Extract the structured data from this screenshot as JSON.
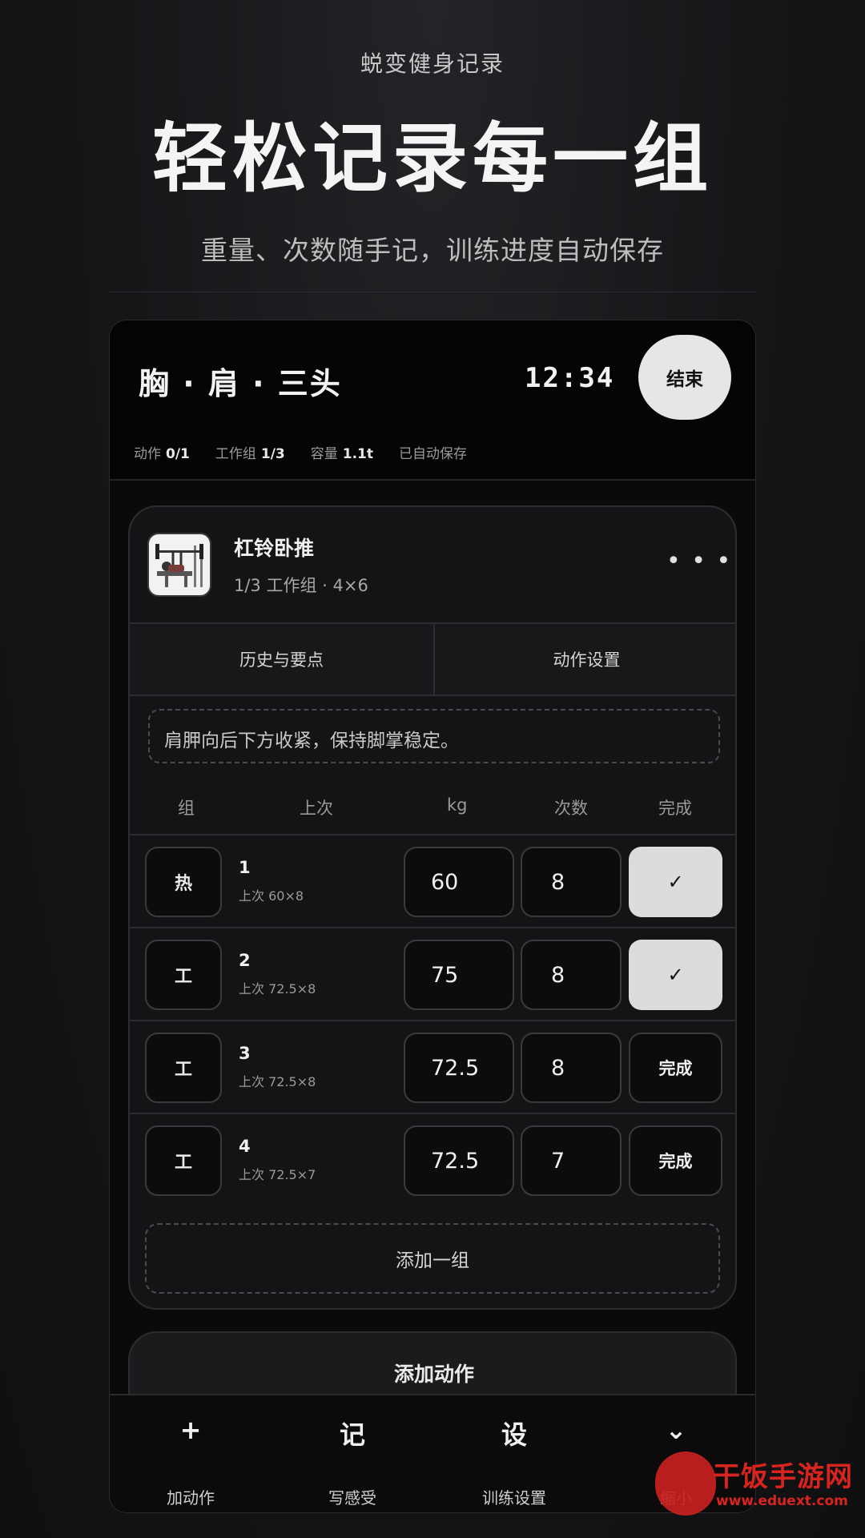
{
  "promo": {
    "subtitle": "蜕变健身记录",
    "title": "轻松记录每一组",
    "description": "重量、次数随手记，训练进度自动保存"
  },
  "header": {
    "session_title": "胸 · 肩 · 三头",
    "timer": "12:34",
    "end_label": "结束",
    "stats": [
      {
        "label": "动作",
        "value": "0/1"
      },
      {
        "label": "工作组",
        "value": "1/3"
      },
      {
        "label": "容量",
        "value": "1.1t"
      },
      {
        "label": "已自动保存",
        "value": ""
      }
    ]
  },
  "exercise": {
    "name": "杠铃卧推",
    "meta": "1/3 工作组 · 4×6",
    "more_icon": "more-icon",
    "tabs": [
      "历史与要点",
      "动作设置"
    ],
    "note": "肩胛向后下方收紧，保持脚掌稳定。",
    "columns": [
      "组",
      "上次",
      "kg",
      "次数",
      "完成"
    ],
    "sets": [
      {
        "type": "热",
        "number": "1",
        "previous": "上次 60×8",
        "kg": "60",
        "reps": "8",
        "done_label": "✓",
        "completed": true
      },
      {
        "type": "工",
        "number": "2",
        "previous": "上次 72.5×8",
        "kg": "75",
        "reps": "8",
        "done_label": "✓",
        "completed": true
      },
      {
        "type": "工",
        "number": "3",
        "previous": "上次 72.5×8",
        "kg": "72.5",
        "reps": "8",
        "done_label": "完成",
        "completed": false
      },
      {
        "type": "工",
        "number": "4",
        "previous": "上次 72.5×7",
        "kg": "72.5",
        "reps": "7",
        "done_label": "完成",
        "completed": false
      }
    ],
    "add_set_label": "添加一组"
  },
  "add_exercise_label": "添加动作",
  "bottom_nav": [
    {
      "glyph": "+",
      "label": "加动作",
      "icon": "plus-icon"
    },
    {
      "glyph": "记",
      "label": "写感受",
      "icon": "note-icon"
    },
    {
      "glyph": "设",
      "label": "训练设置",
      "icon": "settings-icon"
    },
    {
      "glyph": "⌄",
      "label": "缩小",
      "icon": "chevron-down-icon"
    }
  ],
  "watermark": {
    "text": "干饭手游网",
    "url": "www.eduext.com"
  },
  "colors": {
    "background": "#141517",
    "card": "#131416",
    "accent_light": "#dcdcdc",
    "watermark_red": "#d8241f"
  }
}
